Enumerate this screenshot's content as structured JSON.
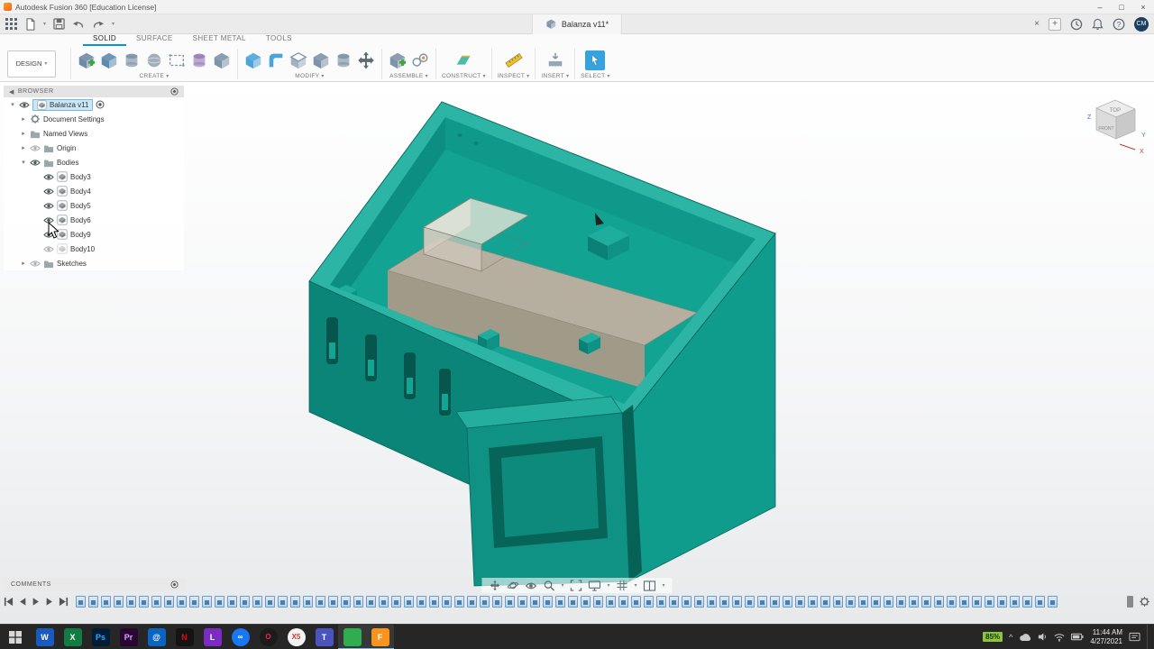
{
  "window": {
    "title": "Autodesk Fusion 360 [Education License]",
    "controls": {
      "minimize": "–",
      "maximize": "□",
      "close": "×"
    }
  },
  "appbar": {
    "document_tab": "Balanza v11*",
    "close_tab": "×",
    "new_tab": "+",
    "avatar": "CM"
  },
  "ribbon": {
    "active_workspace": "DESIGN",
    "tabs": [
      {
        "label": "SOLID"
      },
      {
        "label": "SURFACE"
      },
      {
        "label": "SHEET METAL"
      },
      {
        "label": "TOOLS"
      }
    ],
    "groups": [
      {
        "label": "CREATE"
      },
      {
        "label": "MODIFY"
      },
      {
        "label": "ASSEMBLE"
      },
      {
        "label": "CONSTRUCT"
      },
      {
        "label": "INSPECT"
      },
      {
        "label": "INSERT"
      },
      {
        "label": "SELECT"
      }
    ]
  },
  "browser": {
    "header": "BROWSER",
    "root_label": "Balanza v11",
    "document_settings": "Document Settings",
    "named_views": "Named Views",
    "origin": "Origin",
    "bodies_label": "Bodies",
    "bodies": [
      "Body3",
      "Body4",
      "Body5",
      "Body6",
      "Body9",
      "Body10"
    ],
    "sketches": "Sketches"
  },
  "viewcube": {
    "top": "TOP",
    "front": "FRONT",
    "axis_x": "X",
    "axis_y": "Y",
    "axis_z": "Z"
  },
  "comments": {
    "label": "COMMENTS"
  },
  "timeline": {
    "feature_count": 78
  },
  "model": {
    "document": "Balanza v11",
    "colors": {
      "teal_rim": "#2cb4a4",
      "teal_wall": "#0b8578",
      "teal_floor": "#15a291",
      "beam_gray": "#b6ae9e"
    }
  },
  "taskbar": {
    "apps": [
      {
        "name": "word",
        "label": "W",
        "bg": "#185abd",
        "fg": "#ffffff"
      },
      {
        "name": "excel",
        "label": "X",
        "bg": "#107c41",
        "fg": "#ffffff"
      },
      {
        "name": "photoshop",
        "label": "Ps",
        "bg": "#001e36",
        "fg": "#31a8ff"
      },
      {
        "name": "premiere",
        "label": "Pr",
        "bg": "#2a0634",
        "fg": "#d6a1ff"
      },
      {
        "name": "mail",
        "label": "@",
        "bg": "#0a64c2",
        "fg": "#ffffff"
      },
      {
        "name": "netflix",
        "label": "N",
        "bg": "#141414",
        "fg": "#e50914"
      },
      {
        "name": "app-l",
        "label": "L",
        "bg": "#7b2bbf",
        "fg": "#ffffff"
      },
      {
        "name": "app-infinity",
        "label": "∞",
        "bg": "#1877f2",
        "fg": "#ffffff",
        "cls": "round"
      },
      {
        "name": "opera",
        "label": "O",
        "bg": "#1b1b1b",
        "fg": "#fa1e4e",
        "cls": "round"
      },
      {
        "name": "browser-x5",
        "label": "X5",
        "bg": "#f1f3f4",
        "fg": "#d93025",
        "cls": "round"
      },
      {
        "name": "teams",
        "label": "T",
        "bg": "#4b53bc",
        "fg": "#ffffff"
      },
      {
        "name": "green-app",
        "label": "",
        "bg": "#2fae4f",
        "fg": "#ffffff",
        "cls": "active"
      },
      {
        "name": "fusion-360",
        "label": "F",
        "bg": "#f7941d",
        "fg": "#ffffff",
        "cls": "active"
      }
    ],
    "tray": {
      "battery": "85%",
      "time": "11:44 AM",
      "date": "4/27/2021"
    }
  }
}
